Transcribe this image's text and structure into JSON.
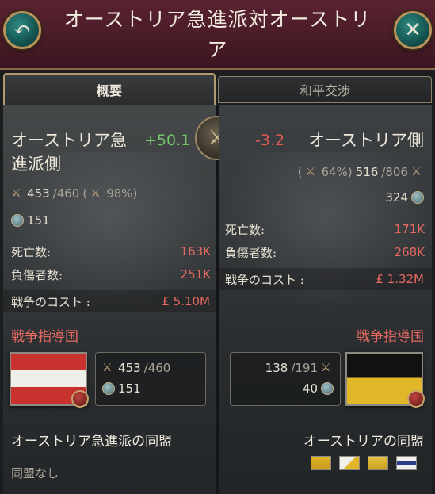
{
  "header": {
    "title": "オーストリア急進派対オーストリア",
    "back_icon": "back-arrow-icon",
    "close_icon": "close-icon"
  },
  "tabs": [
    {
      "label": "概要",
      "active": true
    },
    {
      "label": "和平交渉",
      "active": false
    }
  ],
  "left": {
    "name": "オーストリア急進派側",
    "score": "+50.1",
    "troops": "453",
    "troops_max": "/460",
    "morale": "(",
    "morale_pct": "98%)",
    "manpower": "151",
    "deaths_label": "死亡数:",
    "deaths": "163K",
    "wounded_label": "負傷者数:",
    "wounded": "251K",
    "cost_label": "戦争のコスト :",
    "cost": "£ 5.10M",
    "leader_title": "戦争指導国",
    "leader_troops": "453",
    "leader_troops_max": "/460",
    "leader_manpower": "151",
    "alliance_title": "オーストリア急進派の同盟",
    "alliance_none": "同盟なし"
  },
  "right": {
    "name": "オーストリア側",
    "score": "-3.2",
    "morale_pct": "(",
    "morale_pct_value": "64%)",
    "troops": "516",
    "troops_max": "/806",
    "manpower": "324",
    "deaths_label": "死亡数:",
    "deaths": "171K",
    "wounded_label": "負傷者数:",
    "wounded": "268K",
    "cost_label": "戦争のコスト :",
    "cost": "£ 1.32M",
    "leader_title": "戦争指導国",
    "leader_troops": "138",
    "leader_troops_max": "/191",
    "leader_manpower": "40",
    "alliance_title": "オーストリアの同盟"
  },
  "colors": {
    "header_bg": "#4a1c28",
    "positive": "#72c26a",
    "negative": "#e05a55",
    "accent_gold": "#b9925c",
    "button_teal": "#14544f"
  }
}
